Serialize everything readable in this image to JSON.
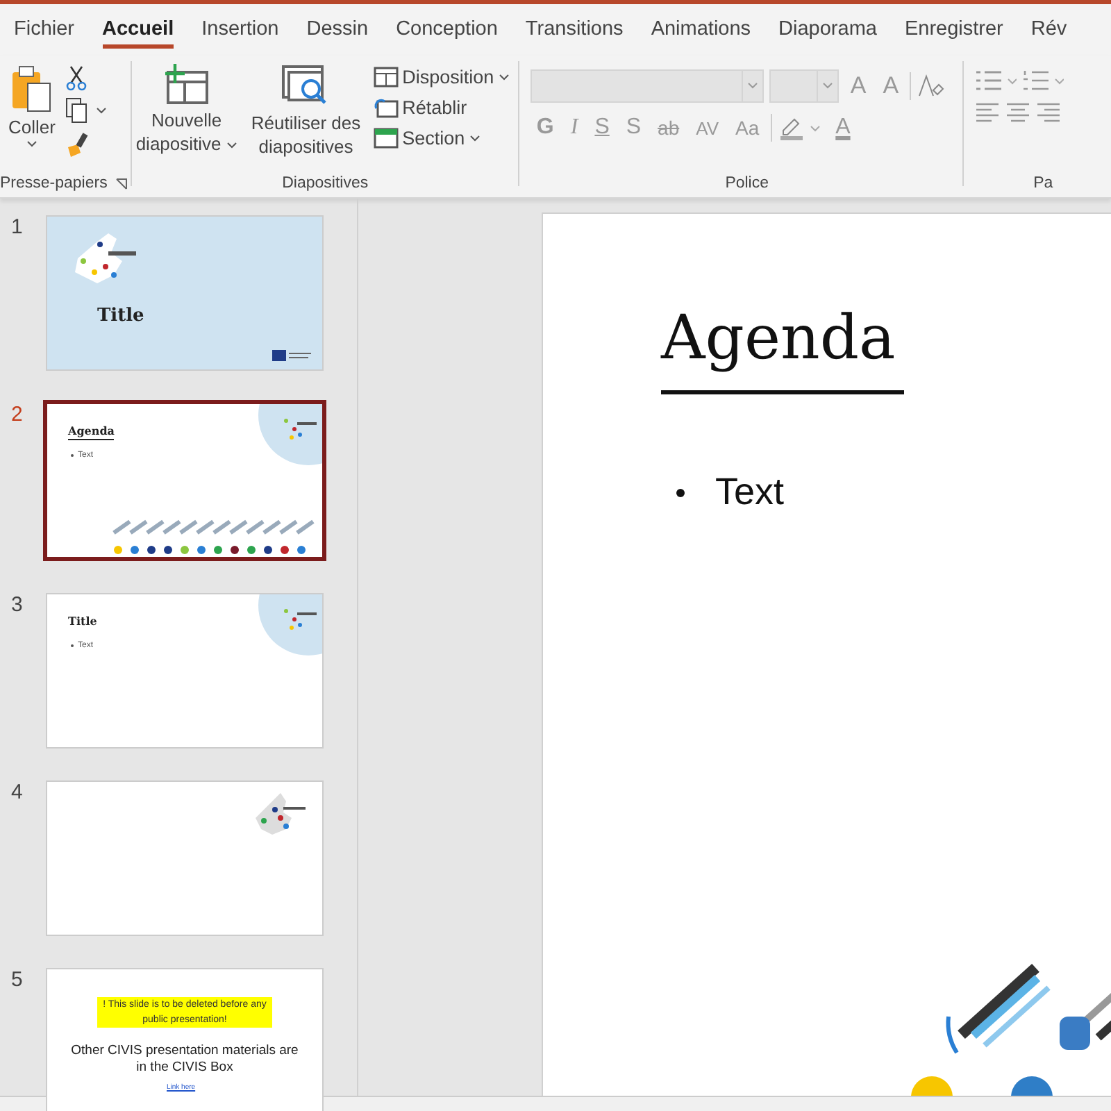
{
  "tabs": [
    {
      "label": "Fichier",
      "selected": false
    },
    {
      "label": "Accueil",
      "selected": true
    },
    {
      "label": "Insertion",
      "selected": false
    },
    {
      "label": "Dessin",
      "selected": false
    },
    {
      "label": "Conception",
      "selected": false
    },
    {
      "label": "Transitions",
      "selected": false
    },
    {
      "label": "Animations",
      "selected": false
    },
    {
      "label": "Diaporama",
      "selected": false
    },
    {
      "label": "Enregistrer",
      "selected": false
    },
    {
      "label": "Rév",
      "selected": false
    }
  ],
  "ribbon": {
    "clipboard": {
      "paste": "Coller",
      "label": "Presse-papiers"
    },
    "slides": {
      "new_slide": [
        "Nouvelle",
        "diapositive"
      ],
      "reuse": [
        "Réutiliser des",
        "diapositives"
      ],
      "layout": "Disposition",
      "reset": "Rétablir",
      "section": "Section",
      "label": "Diapositives"
    },
    "font": {
      "size_buttons": [
        "A",
        "A"
      ],
      "format_buttons": [
        "G",
        "I",
        "S",
        "S",
        "ab",
        "AV",
        "Aa"
      ],
      "color_button": "A",
      "label": "Police"
    },
    "paragraph": {
      "label": "Pa"
    }
  },
  "thumbnails": [
    {
      "number": "1",
      "selected": false,
      "kind": "title",
      "title": "Title"
    },
    {
      "number": "2",
      "selected": true,
      "kind": "agenda",
      "title": "Agenda",
      "bullet": "Text"
    },
    {
      "number": "3",
      "selected": false,
      "kind": "content",
      "title": "Title",
      "bullet": "Text"
    },
    {
      "number": "4",
      "selected": false,
      "kind": "blank"
    },
    {
      "number": "5",
      "selected": false,
      "kind": "note",
      "warning": "! This slide is to be deleted before any public presentation!",
      "body": "Other CIVIS presentation materials are in the CIVIS Box",
      "link": "Link here"
    }
  ],
  "slide": {
    "title": "Agenda",
    "bullet": "Text"
  }
}
